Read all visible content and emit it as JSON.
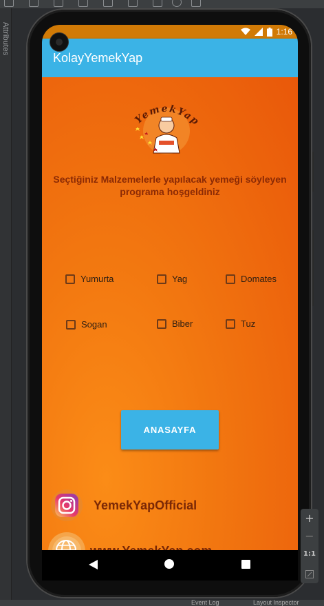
{
  "ide": {
    "attributes_label": "Attributes",
    "zoom": {
      "plus": "+",
      "minus": "−",
      "ratio": "1:1"
    },
    "bottom": {
      "event_log": "Event Log",
      "layout_inspector": "Layout Inspector"
    }
  },
  "status": {
    "time": "1:16"
  },
  "app": {
    "title": "KolayYemekYap"
  },
  "logo": {
    "text": "YemekYap"
  },
  "welcome": {
    "line1": "Seçtiğiniz Malzemelerle yapılacak yemeği söyleyen",
    "line2": "programa hoşgeldiniz"
  },
  "ingredients": [
    {
      "label": "Yumurta",
      "checked": false
    },
    {
      "label": "Yag",
      "checked": false
    },
    {
      "label": "Domates",
      "checked": false
    },
    {
      "label": "Sogan",
      "checked": false
    },
    {
      "label": "Biber",
      "checked": false
    },
    {
      "label": "Tuz",
      "checked": false
    }
  ],
  "button": {
    "label": "ANASAYFA"
  },
  "social": {
    "instagram": "YemekYapOfficial",
    "website": "www.YemekYap.com"
  },
  "colors": {
    "appbar": "#3bb3e6",
    "statusbar": "#d17a06",
    "content_orange": "#f27710",
    "text_dark_red": "#8b2a05"
  }
}
